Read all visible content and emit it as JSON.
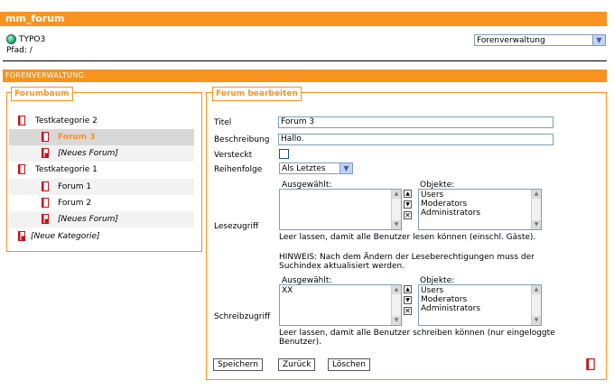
{
  "window": {
    "title": "mm_forum"
  },
  "header": {
    "root": "TYPO3",
    "path": "Pfad: /",
    "module_select": "Forenverwaltung"
  },
  "section": {
    "title": "FORENVERWALTUNG:"
  },
  "tree": {
    "legend": "Forumbaum",
    "items": [
      {
        "label": "Testkategorie 2"
      },
      {
        "label": "Forum 3"
      },
      {
        "label": "[Neues Forum]"
      },
      {
        "label": "Testkategorie 1"
      },
      {
        "label": "Forum 1"
      },
      {
        "label": "Forum 2"
      },
      {
        "label": "[Neues Forum]"
      },
      {
        "label": "[Neue Kategorie]"
      }
    ]
  },
  "form": {
    "legend": "Forum bearbeiten",
    "title_label": "Titel",
    "title_value": "Forum 3",
    "desc_label": "Beschreibung",
    "desc_value": "Hallo.",
    "hidden_label": "Versteckt",
    "order_label": "Reihenfolge",
    "order_value": "Als Letztes",
    "read": {
      "label": "Lesezugriff",
      "selected_label": "Ausgewählt:",
      "objects_label": "Objekte:",
      "selected": [],
      "objects": [
        "Users",
        "Moderators",
        "Administrators"
      ],
      "hint": "Leer lassen, damit alle Benutzer lesen können (einschl. Gäste).",
      "notice_1": "HINWEIS: Nach dem Ändern der Leseberechtigungen muss der",
      "notice_2": "Suchindex aktualisiert werden."
    },
    "write": {
      "label": "Schreibzugriff",
      "selected_label": "Ausgewählt:",
      "objects_label": "Objekte:",
      "selected": [
        "XX"
      ],
      "objects": [
        "Users",
        "Moderators",
        "Administrators"
      ],
      "hint_1": "Leer lassen, damit alle Benutzer schreiben können (nur eingeloggte",
      "hint_2": "Benutzer)."
    },
    "buttons": {
      "save": "Speichern",
      "back": "Zurück",
      "delete": "Löschen"
    }
  },
  "colors": {
    "accent": "#f7931e",
    "doc_red": "#c0141b"
  }
}
